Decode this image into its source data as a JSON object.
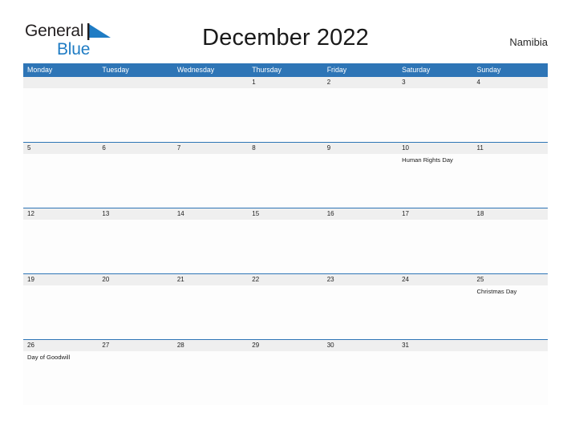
{
  "brand": {
    "word1": "General",
    "word2": "Blue",
    "flag_icon": "blue-triangle-flag-icon",
    "color_dark": "#231f20",
    "color_blue": "#1f7cc4"
  },
  "header": {
    "title": "December 2022",
    "region": "Namibia"
  },
  "theme": {
    "header_blue": "#2e75b6",
    "date_strip_gray": "#efefef",
    "cell_white": "#fdfdfd",
    "text_dark": "#1a1a1a"
  },
  "calendar": {
    "weekdays": [
      "Monday",
      "Tuesday",
      "Wednesday",
      "Thursday",
      "Friday",
      "Saturday",
      "Sunday"
    ],
    "weeks": [
      {
        "days": [
          {
            "date": "",
            "events": []
          },
          {
            "date": "",
            "events": []
          },
          {
            "date": "",
            "events": []
          },
          {
            "date": "1",
            "events": []
          },
          {
            "date": "2",
            "events": []
          },
          {
            "date": "3",
            "events": []
          },
          {
            "date": "4",
            "events": []
          }
        ]
      },
      {
        "days": [
          {
            "date": "5",
            "events": []
          },
          {
            "date": "6",
            "events": []
          },
          {
            "date": "7",
            "events": []
          },
          {
            "date": "8",
            "events": []
          },
          {
            "date": "9",
            "events": []
          },
          {
            "date": "10",
            "events": [
              "Human Rights Day"
            ]
          },
          {
            "date": "11",
            "events": []
          }
        ]
      },
      {
        "days": [
          {
            "date": "12",
            "events": []
          },
          {
            "date": "13",
            "events": []
          },
          {
            "date": "14",
            "events": []
          },
          {
            "date": "15",
            "events": []
          },
          {
            "date": "16",
            "events": []
          },
          {
            "date": "17",
            "events": []
          },
          {
            "date": "18",
            "events": []
          }
        ]
      },
      {
        "days": [
          {
            "date": "19",
            "events": []
          },
          {
            "date": "20",
            "events": []
          },
          {
            "date": "21",
            "events": []
          },
          {
            "date": "22",
            "events": []
          },
          {
            "date": "23",
            "events": []
          },
          {
            "date": "24",
            "events": []
          },
          {
            "date": "25",
            "events": [
              "Christmas Day"
            ]
          }
        ]
      },
      {
        "days": [
          {
            "date": "26",
            "events": [
              "Day of Goodwill"
            ]
          },
          {
            "date": "27",
            "events": []
          },
          {
            "date": "28",
            "events": []
          },
          {
            "date": "29",
            "events": []
          },
          {
            "date": "30",
            "events": []
          },
          {
            "date": "31",
            "events": []
          },
          {
            "date": "",
            "events": []
          }
        ]
      }
    ]
  }
}
